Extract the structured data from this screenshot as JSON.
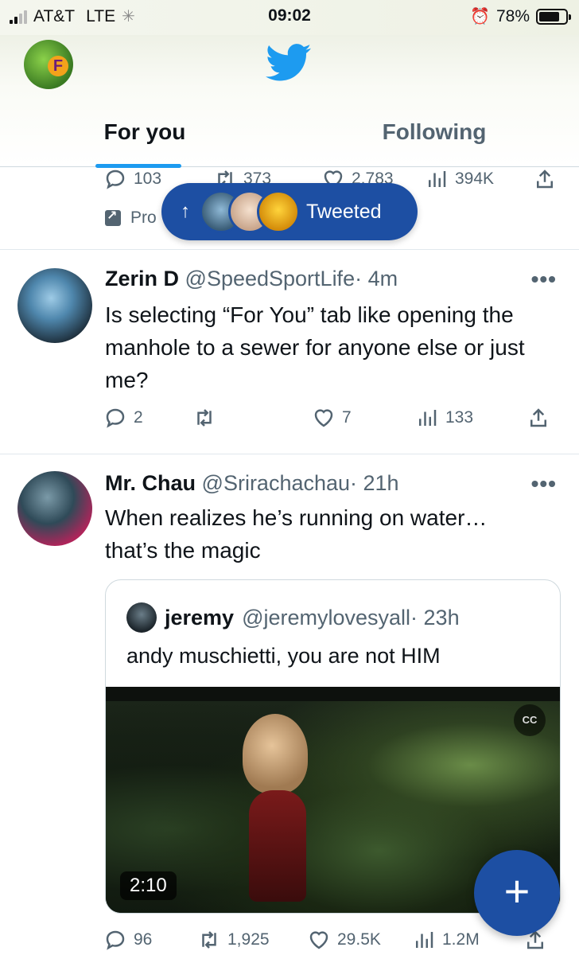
{
  "status_bar": {
    "carrier": "AT&T",
    "network": "LTE",
    "time": "09:02",
    "battery": "78%",
    "battery_level": 0.78
  },
  "header": {
    "logo": "twitter-bird-icon",
    "tabs": [
      {
        "label": "For you",
        "active": true
      },
      {
        "label": "Following",
        "active": false
      }
    ]
  },
  "partial_tweet": {
    "replies": "103",
    "retweets": "373",
    "likes": "2,783",
    "views": "394K",
    "promoted_label": "Pro"
  },
  "new_tweets_pill": {
    "arrow": "↑",
    "label": "Tweeted"
  },
  "tweets": [
    {
      "name": "Zerin D",
      "handle": "@SpeedSportLife",
      "time": "· 4m",
      "text": "Is selecting “For You” tab like opening the manhole to a sewer for anyone else or just me?",
      "replies": "2",
      "retweets": "",
      "likes": "7",
      "views": "133"
    },
    {
      "name": "Mr. Chau",
      "handle": "@Srirachachau",
      "time": "· 21h",
      "text": "When realizes he’s running on water… that’s the magic",
      "replies": "96",
      "retweets": "1,925",
      "likes": "29.5K",
      "views": "1.2M",
      "quote": {
        "name": "jeremy",
        "handle": "@jeremylovesyall",
        "time": "· 23h",
        "text": "andy muschietti, you are not HIM",
        "video_duration": "2:10"
      }
    }
  ],
  "more_icon": "•••",
  "compose_button": "+",
  "colors": {
    "accent": "#1d9bf0",
    "pill": "#1d4fa3",
    "secondary_text": "#536471"
  }
}
